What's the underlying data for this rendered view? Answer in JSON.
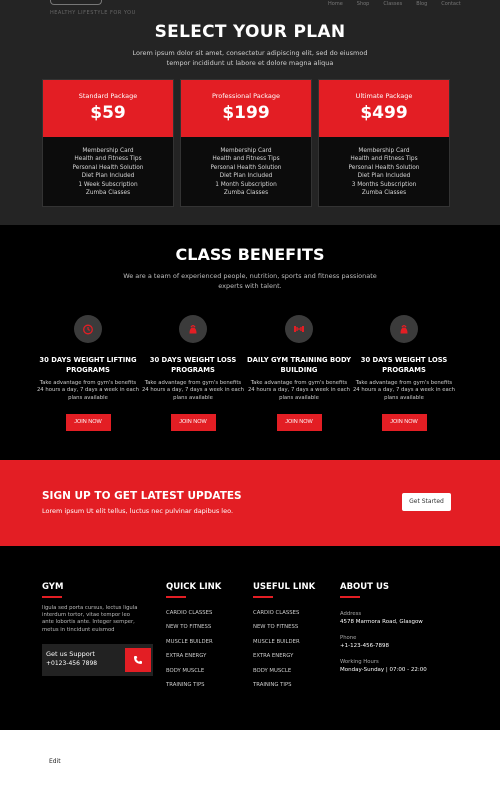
{
  "nav": {
    "logo_sub": "HEALTHY LIFESTYLE FOR YOU",
    "links": [
      "Home",
      "Shop",
      "Classes",
      "Blog",
      "Contact"
    ]
  },
  "plans": {
    "title": "SELECT YOUR PLAN",
    "subtitle": "Lorem ipsum dolor sit amet, consectetur adipiscing elit, sed do eiusmod tempor incididunt ut labore et dolore magna aliqua",
    "items": [
      {
        "name": "Standard Package",
        "price": "$59",
        "features": [
          "Membership Card",
          "Health and Fitness Tips",
          "Personal Health Solution",
          "Diet Plan Included",
          "1 Week Subscription",
          "Zumba Classes"
        ]
      },
      {
        "name": "Professional Package",
        "price": "$199",
        "features": [
          "Membership Card",
          "Health and Fitness Tips",
          "Personal Health Solution",
          "Diet Plan Included",
          "1 Month Subscription",
          "Zumba Classes"
        ]
      },
      {
        "name": "Ultimate Package",
        "price": "$499",
        "features": [
          "Membership Card",
          "Health and Fitness Tips",
          "Personal Health Solution",
          "Diet Plan Included",
          "3 Months Subscription",
          "Zumba Classes"
        ]
      }
    ]
  },
  "benefits": {
    "title": "CLASS BENEFITS",
    "subtitle": "We are a team of experienced people, nutrition, sports and fitness passionate experts with talent.",
    "items": [
      {
        "title": "30 DAYS WEIGHT LIFTING PROGRAMS",
        "text": "Take advantage from gym's benefits 24 hours a day, 7 days a week in each plans available",
        "button": "JOIN NOW",
        "icon": "timer-icon"
      },
      {
        "title": "30 DAYS WEIGHT LOSS PROGRAMS",
        "text": "Take advantage from gym's benefits 24 hours a day, 7 days a week in each plans available",
        "button": "JOIN NOW",
        "icon": "kettlebell-icon"
      },
      {
        "title": "DAILY GYM TRAINING BODY BUILDING",
        "text": "Take advantage from gym's benefits 24 hours a day, 7 days a week in each plans available",
        "button": "JOIN NOW",
        "icon": "dumbbell-icon"
      },
      {
        "title": "30 DAYS WEIGHT LOSS PROGRAMS",
        "text": "Take advantage from gym's benefits 24 hours a day, 7 days a week in each plans available",
        "button": "JOIN NOW",
        "icon": "kettlebell-icon"
      }
    ]
  },
  "signup": {
    "title": "SIGN UP TO GET LATEST UPDATES",
    "text": "Lorem ipsum Ut elit tellus, luctus nec pulvinar dapibus leo.",
    "button": "Get Started"
  },
  "footer": {
    "gym": {
      "title": "GYM",
      "text": "ligula sed porta cursus, lectus ligula interdum tortor, vitae tempor leo ante lobortis ante. Integer semper, metus in tincidunt euismod",
      "support_label": "Get us Support",
      "support_number": "+0123-456 7898"
    },
    "quick": {
      "title": "QUICK LINK",
      "links": [
        "CARDIO CLASSES",
        "NEW TO FITNESS",
        "MUSCLE BUILDER",
        "EXTRA ENERGY",
        "BODY MUSCLE",
        "TRAINING TIPS"
      ]
    },
    "useful": {
      "title": "USEFUL LINK",
      "links": [
        "CARDIO CLASSES",
        "NEW TO FITNESS",
        "MUSCLE BUILDER",
        "EXTRA ENERGY",
        "BODY MUSCLE",
        "TRAINING TIPS"
      ]
    },
    "about": {
      "title": "ABOUT US",
      "address_label": "Address",
      "address": "4578 Marmora Road, Glasgow",
      "phone_label": "Phone",
      "phone": "+1-123-456-7898",
      "hours_label": "Working Hours",
      "hours": "Monday-Sunday | 07:00 - 22:00"
    }
  },
  "bottom": {
    "edit": "Edit"
  },
  "colors": {
    "accent": "#e31e24",
    "dark": "#242424",
    "black": "#000000"
  }
}
